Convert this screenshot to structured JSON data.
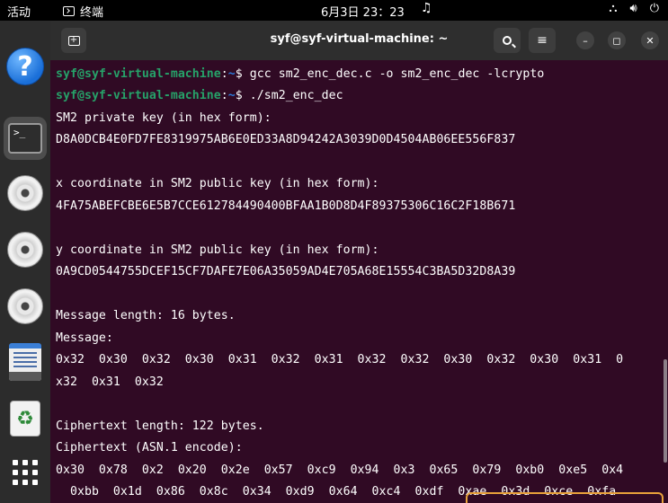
{
  "topbar": {
    "activities": "活动",
    "app_name": "终端",
    "clock": "6月3日  23：23",
    "bell_icon": "bell-icon",
    "tray_icons": [
      "network-icon",
      "volume-icon",
      "power-icon"
    ]
  },
  "dock": {
    "items": [
      "help-icon",
      "terminal-icon",
      "disc-icon",
      "disc-icon",
      "disc-icon",
      "text-editor-icon",
      "trash-icon",
      "app-grid-icon"
    ],
    "terminal_glyph": ">_"
  },
  "window": {
    "title": "syf@syf-virtual-machine: ~",
    "newtab_glyph": "+",
    "search_icon": "search-icon",
    "menu_glyph": "≡",
    "minimize_glyph": "–",
    "maximize_glyph": "◻",
    "close_glyph": "✕"
  },
  "terminal": {
    "prompt_user": "syf@syf-virtual-machine",
    "prompt_sep": ":",
    "prompt_path": "~",
    "prompt_dollar": "$",
    "cmd1": " gcc sm2_enc_dec.c -o sm2_enc_dec -lcrypto",
    "cmd2": " ./sm2_enc_dec",
    "lines": [
      "SM2 private key (in hex form):",
      "D8A0DCB4E0FD7FE8319975AB6E0ED33A8D94242A3039D0D4504AB06EE556F837",
      "",
      "x coordinate in SM2 public key (in hex form):",
      "4FA75ABEFCBE6E5B7CCE612784490400BFAA1B0D8D4F89375306C16C2F18B671",
      "",
      "y coordinate in SM2 public key (in hex form):",
      "0A9CD0544755DCEF15CF7DAFE7E06A35059AD4E705A68E15554C3BA5D32D8A39",
      "",
      "Message length: 16 bytes.",
      "Message:",
      "0x32  0x30  0x32  0x30  0x31  0x32  0x31  0x32  0x32  0x30  0x32  0x30  0x31  0",
      "x32  0x31  0x32",
      "",
      "Ciphertext length: 122 bytes.",
      "Ciphertext (ASN.1 encode):",
      "0x30  0x78  0x2  0x20  0x2e  0x57  0xc9  0x94  0x3  0x65  0x79  0xb0  0xe5  0x4",
      "  0xbb  0x1d  0x86  0x8c  0x34  0xd9  0x64  0xc4  0xdf  0xae  0x3d  0xce  0xfa"
    ]
  }
}
